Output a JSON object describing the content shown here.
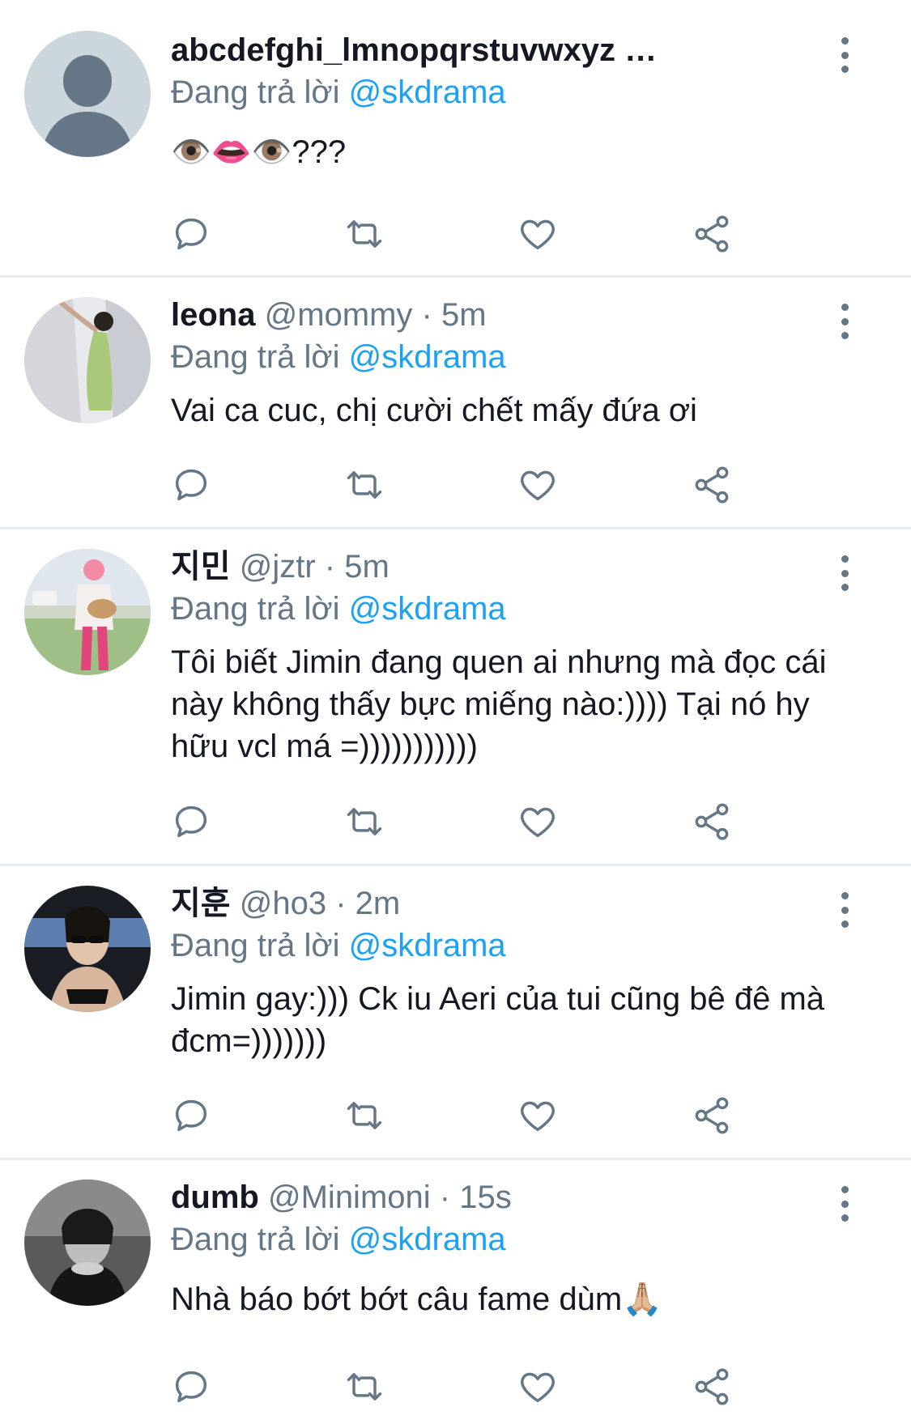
{
  "tweets": [
    {
      "name": "abcdefghi_lmnopqrstuvwxyz …",
      "handle": "",
      "time": "",
      "reply_prefix": "Đang trả lời",
      "reply_to": "@skdrama",
      "text": "👁️👄👁️???",
      "avatar": "default-avatar"
    },
    {
      "name": "leona",
      "handle": "@mommy",
      "time": "5m",
      "reply_prefix": "Đang trả lời",
      "reply_to": "@skdrama",
      "text": "Vai ca cuc, chị cười chết mấy đứa ơi",
      "avatar": "photo-avatar"
    },
    {
      "name": "지민",
      "handle": "@jztr",
      "time": "5m",
      "reply_prefix": "Đang trả lời",
      "reply_to": "@skdrama",
      "text": "Tôi biết Jimin đang quen ai nhưng mà đọc cái này không thấy bực miếng nào:)))) Tại nó hy hữu vcl má =)))))))))))",
      "avatar": "photo-avatar"
    },
    {
      "name": "지훈",
      "handle": "@ho3",
      "time": "2m",
      "reply_prefix": "Đang trả lời",
      "reply_to": "@skdrama",
      "text": "Jimin gay:))) Ck iu Aeri của tui cũng bê đê mà đcm=)))))))",
      "avatar": "photo-avatar"
    },
    {
      "name": "dumb",
      "handle": "@Minimoni",
      "time": "15s",
      "reply_prefix": "Đang trả lời",
      "reply_to": "@skdrama",
      "text": "Nhà báo bớt bớt câu fame dùm🙏🏼",
      "avatar": "photo-avatar"
    }
  ],
  "separator": "·",
  "icons": [
    "more-vertical-icon",
    "reply-icon",
    "retweet-icon",
    "like-icon",
    "share-icon"
  ],
  "colors": {
    "link": "#1da1f2",
    "muted": "#657786",
    "text": "#141823",
    "divider": "#e6ecf0"
  }
}
